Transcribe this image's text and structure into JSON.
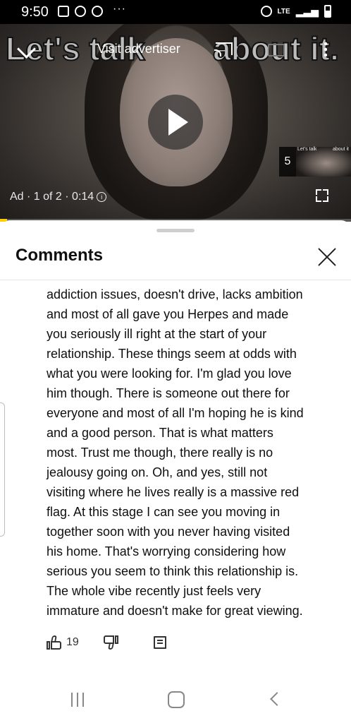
{
  "status_bar": {
    "time": "9:50",
    "network": "LTE",
    "icons": [
      "gallery-icon",
      "pinterest-icon",
      "command-icon",
      "more-dots-icon",
      "alarm-icon",
      "lte-icon",
      "signal-icon",
      "battery-icon"
    ]
  },
  "video_ad": {
    "overlay_title_left": "Let's talk",
    "overlay_title_right": "about it.",
    "visit_label": "Visit advertiser",
    "ad_info": "Ad · 1 of 2 · 0:14",
    "skip_countdown": "5",
    "thumb_text_left": "Let's talk",
    "thumb_text_right": "about it",
    "progress_fraction": 0.02,
    "progress_color": "#ffcc00"
  },
  "comments_panel": {
    "title": "Comments",
    "comment_lines": [
      "addiction issues, doesn't drive, lacks ambition",
      "and most of all gave you Herpes and made",
      "you seriously ill right at the start of your",
      "relationship. These things seem at odds with",
      "what you were looking for. I'm glad you love",
      "him though. There is someone out there for",
      "everyone and most of all I'm hoping he is kind",
      "and a good person. That is what matters",
      "most. Trust me though, there really is no",
      "jealousy going on.  Oh, and yes, still not",
      "visiting where he lives really is a massive red",
      "flag. At this stage I can see you moving in",
      "together soon with you never having visited",
      "his home. That's worrying considering how",
      "serious you seem to think this relationship is.",
      "The whole vibe recently just feels very",
      "immature and doesn't make for great viewing."
    ],
    "like_count": "19"
  }
}
